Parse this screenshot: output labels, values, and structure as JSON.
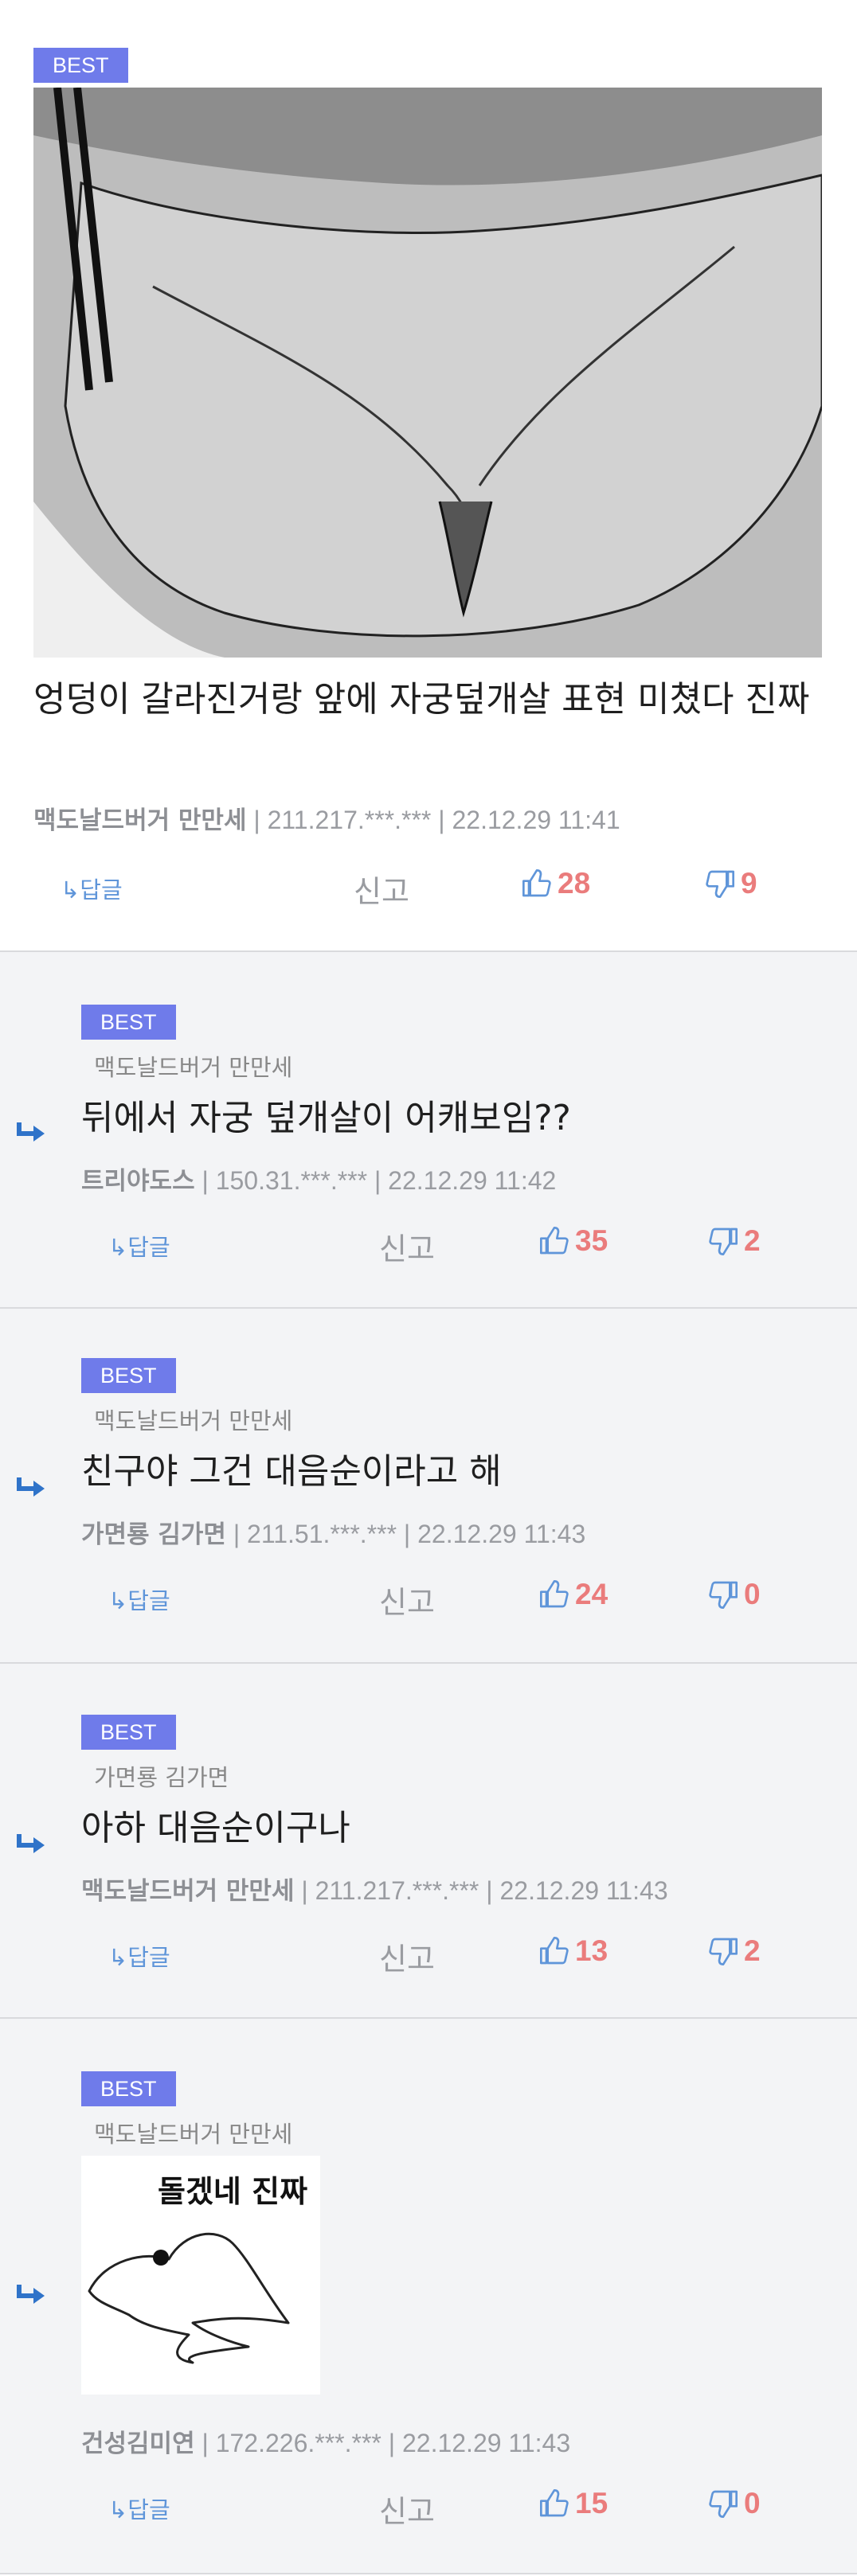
{
  "post": {
    "badge": "BEST",
    "title": "엉덩이 갈라진거랑 앞에 자궁덮개살 표현 미쳤다 진짜",
    "author": "맥도날드버거 만만세",
    "ip": "211.217.***.***",
    "date": "22.12.29 11:41",
    "reply_label": "↳답글",
    "report_label": "신고",
    "likes": "28",
    "dislikes": "9"
  },
  "replies": [
    {
      "badge": "BEST",
      "parent": "맥도날드버거 만만세",
      "text": "뒤에서 자궁 덮개살이 어캐보임??",
      "author": "트리야도스",
      "ip": "150.31.***.***",
      "date": "22.12.29 11:42",
      "reply_label": "↳답글",
      "report_label": "신고",
      "likes": "35",
      "dislikes": "2"
    },
    {
      "badge": "BEST",
      "parent": "맥도날드버거 만만세",
      "text": "친구야 그건 대음순이라고 해",
      "author": "가면룡 김가면",
      "ip": "211.51.***.***",
      "date": "22.12.29 11:43",
      "reply_label": "↳답글",
      "report_label": "신고",
      "likes": "24",
      "dislikes": "0"
    },
    {
      "badge": "BEST",
      "parent": "가면룡 김가면",
      "text": "아하 대음순이구나",
      "author": "맥도날드버거 만만세",
      "ip": "211.217.***.***",
      "date": "22.12.29 11:43",
      "reply_label": "↳답글",
      "report_label": "신고",
      "likes": "13",
      "dislikes": "2"
    },
    {
      "badge": "BEST",
      "parent": "맥도날드버거 만만세",
      "sticker_text": "돌겠네 진짜",
      "author": "건성김미연",
      "ip": "172.226.***.***",
      "date": "22.12.29 11:43",
      "reply_label": "↳답글",
      "report_label": "신고",
      "likes": "15",
      "dislikes": "0"
    }
  ],
  "colors": {
    "badge": "#6f7bea",
    "reply_link": "#5f95d9",
    "vote": "#ea7c7c",
    "meta": "#9a9ca1",
    "reply_bg": "#f3f4f6"
  },
  "icons": {
    "like": "thumbs-up-icon",
    "dislike": "thumbs-down-icon",
    "reply_arrow": "reply-arrow-icon"
  }
}
